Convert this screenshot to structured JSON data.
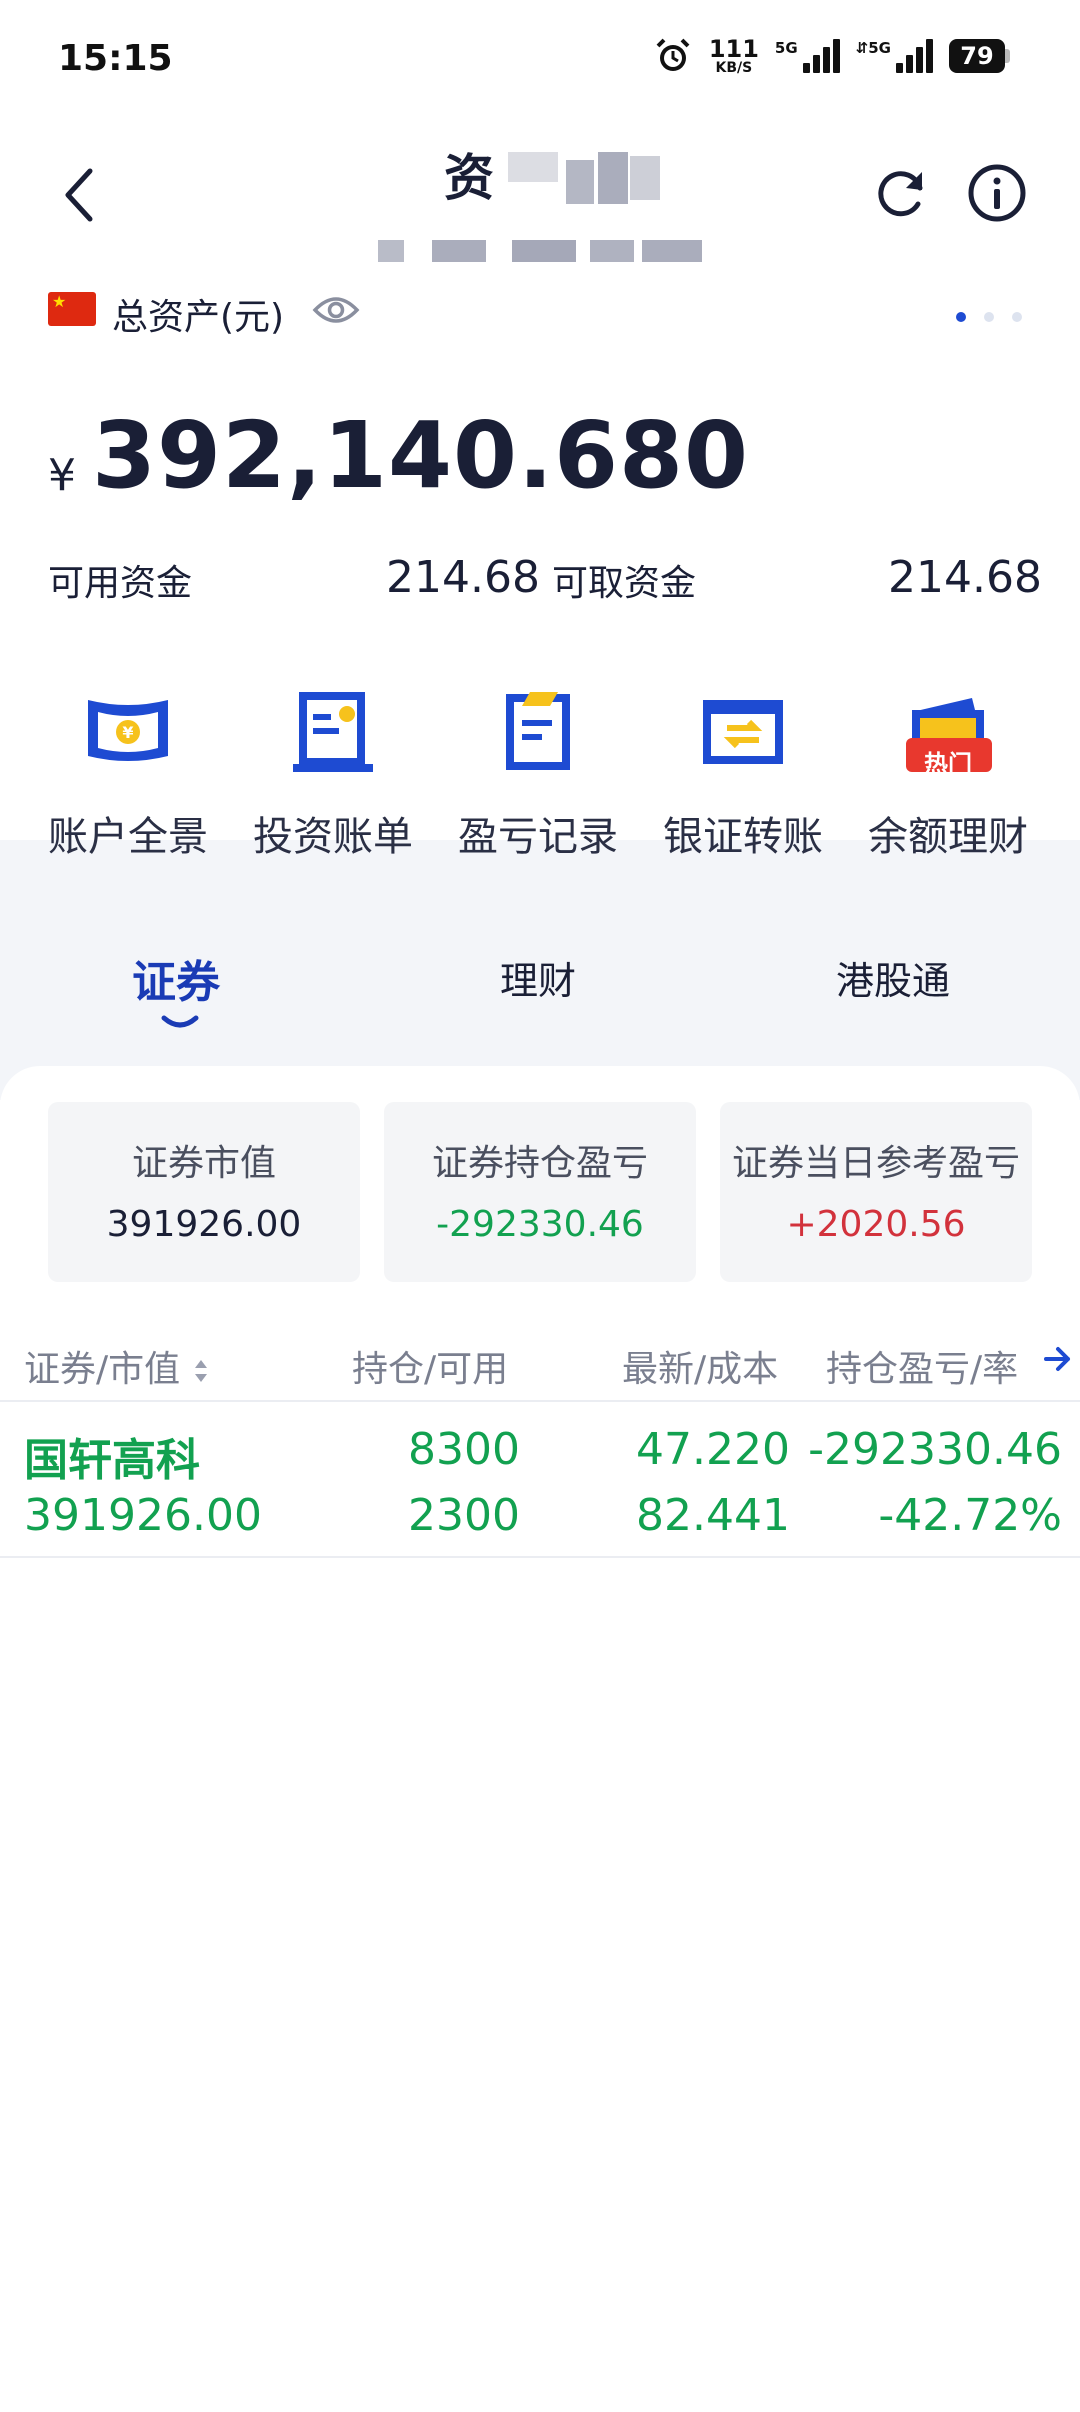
{
  "status_bar": {
    "time": "15:15",
    "net_speed": "111",
    "net_unit": "KB/S",
    "sim1_label": "5G",
    "sim2_label": "5G",
    "battery": "79"
  },
  "header": {
    "title_visible": "资"
  },
  "assets": {
    "label": "总资产(元)",
    "currency_symbol": "¥",
    "total": "392,140.680",
    "available_funds_label": "可用资金",
    "available_funds_value": "214.68",
    "withdrawable_funds_label": "可取资金",
    "withdrawable_funds_value": "214.68"
  },
  "quick_actions": [
    {
      "label": "账户全景"
    },
    {
      "label": "投资账单"
    },
    {
      "label": "盈亏记录"
    },
    {
      "label": "银证转账"
    },
    {
      "label": "余额理财",
      "badge": "热门"
    }
  ],
  "tabs": [
    {
      "label": "证券",
      "active": true
    },
    {
      "label": "理财",
      "active": false
    },
    {
      "label": "港股通",
      "active": false
    }
  ],
  "summary_cards": [
    {
      "title": "证券市值",
      "value": "391926.00"
    },
    {
      "title": "证券持仓盈亏",
      "value": "-292330.46"
    },
    {
      "title": "证券当日参考盈亏",
      "value": "+2020.56"
    }
  ],
  "table": {
    "headers": [
      "证券/市值",
      "持仓/可用",
      "最新/成本",
      "持仓盈亏/率"
    ],
    "rows": [
      {
        "name": "国轩高科",
        "market_value": "391926.00",
        "position": "8300",
        "available": "2300",
        "latest": "47.220",
        "cost": "82.441",
        "pnl": "-292330.46",
        "pnl_rate": "-42.72%"
      }
    ]
  },
  "colors": {
    "brand_blue": "#1e4bd2",
    "loss_green": "#12a150",
    "gain_red": "#d2323c",
    "hot_badge": "#e8382e"
  }
}
